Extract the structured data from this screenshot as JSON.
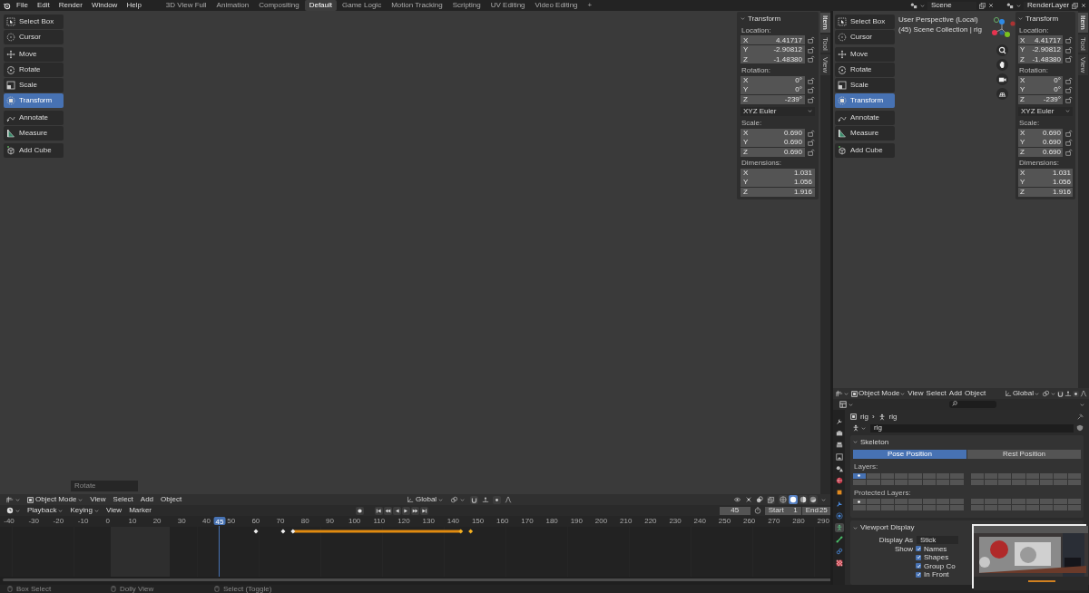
{
  "top_bar": {
    "menus": [
      "File",
      "Edit",
      "Render",
      "Window",
      "Help"
    ],
    "workspaces": [
      {
        "label": "3D View Full",
        "selected": false
      },
      {
        "label": "Animation",
        "selected": false
      },
      {
        "label": "Compositing",
        "selected": false
      },
      {
        "label": "Default",
        "selected": true
      },
      {
        "label": "Game Logic",
        "selected": false
      },
      {
        "label": "Motion Tracking",
        "selected": false
      },
      {
        "label": "Scripting",
        "selected": false
      },
      {
        "label": "UV Editing",
        "selected": false
      },
      {
        "label": "Video Editing",
        "selected": false
      }
    ],
    "add_workspace": "+",
    "scene": "Scene",
    "view_layer": "RenderLayer"
  },
  "main_viewport": {
    "tool_groups": [
      {
        "tools": [
          {
            "label": "Select Box",
            "selected": false
          },
          {
            "label": "Cursor",
            "selected": false
          }
        ]
      },
      {
        "tools": [
          {
            "label": "Move",
            "selected": false
          },
          {
            "label": "Rotate",
            "selected": false
          },
          {
            "label": "Scale",
            "selected": false
          },
          {
            "label": "Transform",
            "selected": true
          }
        ]
      },
      {
        "tools": [
          {
            "label": "Annotate",
            "selected": false
          },
          {
            "label": "Measure",
            "selected": false
          }
        ]
      },
      {
        "tools": [
          {
            "label": "Add Cube",
            "selected": false
          }
        ]
      }
    ],
    "last_operator": "Rotate",
    "sidebar": {
      "title": "Transform",
      "groups": [
        {
          "kind": "vector",
          "label": "Location:",
          "fields": [
            {
              "axis": "X",
              "value": "4.41717",
              "locked": false
            },
            {
              "axis": "Y",
              "value": "-2.90812",
              "locked": false
            },
            {
              "axis": "Z",
              "value": "-1.48380",
              "locked": false
            }
          ]
        },
        {
          "kind": "vector",
          "label": "Rotation:",
          "fields": [
            {
              "axis": "X",
              "value": "0°",
              "locked": false
            },
            {
              "axis": "Y",
              "value": "0°",
              "locked": false
            },
            {
              "axis": "Z",
              "value": "-239°",
              "locked": false
            }
          ]
        },
        {
          "kind": "dropdown",
          "value": "XYZ Euler"
        },
        {
          "kind": "vector",
          "label": "Scale:",
          "fields": [
            {
              "axis": "X",
              "value": "0.690",
              "locked": false
            },
            {
              "axis": "Y",
              "value": "0.690",
              "locked": false
            },
            {
              "axis": "Z",
              "value": "0.690",
              "locked": false
            }
          ]
        },
        {
          "kind": "vector",
          "label": "Dimensions:",
          "fields": [
            {
              "axis": "X",
              "value": "1.031"
            },
            {
              "axis": "Y",
              "value": "1.056"
            },
            {
              "axis": "Z",
              "value": "1.916"
            }
          ]
        }
      ]
    },
    "sidebar_tabs": [
      {
        "label": "Item",
        "selected": true
      },
      {
        "label": "Tool",
        "selected": false
      },
      {
        "label": "View",
        "selected": false
      }
    ],
    "header": {
      "mode": "Object Mode",
      "menus": [
        "View",
        "Select",
        "Add",
        "Object"
      ],
      "orientation": "Global",
      "shading": [
        {
          "selected": false
        },
        {
          "selected": true
        },
        {
          "selected": false
        },
        {
          "selected": false
        }
      ]
    }
  },
  "side_viewport": {
    "overlay_text": [
      "User Perspective (Local)",
      "(45) Scene Collection | rig"
    ],
    "tool_groups": [
      {
        "tools": [
          {
            "label": "Select Box",
            "selected": false
          },
          {
            "label": "Cursor",
            "selected": false
          }
        ]
      },
      {
        "tools": [
          {
            "label": "Move",
            "selected": false
          },
          {
            "label": "Rotate",
            "selected": false
          },
          {
            "label": "Scale",
            "selected": false
          },
          {
            "label": "Transform",
            "selected": true
          }
        ]
      },
      {
        "tools": [
          {
            "label": "Annotate",
            "selected": false
          },
          {
            "label": "Measure",
            "selected": false
          }
        ]
      },
      {
        "tools": [
          {
            "label": "Add Cube",
            "selected": false
          }
        ]
      }
    ],
    "sidebar": {
      "title": "Transform",
      "groups": [
        {
          "kind": "vector",
          "label": "Location:",
          "fields": [
            {
              "axis": "X",
              "value": "4.41717",
              "locked": false
            },
            {
              "axis": "Y",
              "value": "-2.90812",
              "locked": false
            },
            {
              "axis": "Z",
              "value": "-1.48380",
              "locked": false
            }
          ]
        },
        {
          "kind": "vector",
          "label": "Rotation:",
          "fields": [
            {
              "axis": "X",
              "value": "0°",
              "locked": false
            },
            {
              "axis": "Y",
              "value": "0°",
              "locked": false
            },
            {
              "axis": "Z",
              "value": "-239°",
              "locked": false
            }
          ]
        },
        {
          "kind": "dropdown",
          "value": "XYZ Euler"
        },
        {
          "kind": "vector",
          "label": "Scale:",
          "fields": [
            {
              "axis": "X",
              "value": "0.690",
              "locked": false
            },
            {
              "axis": "Y",
              "value": "0.690",
              "locked": false
            },
            {
              "axis": "Z",
              "value": "0.690",
              "locked": false
            }
          ]
        },
        {
          "kind": "vector",
          "label": "Dimensions:",
          "fields": [
            {
              "axis": "X",
              "value": "1.031"
            },
            {
              "axis": "Y",
              "value": "1.056"
            },
            {
              "axis": "Z",
              "value": "1.916"
            }
          ]
        }
      ]
    },
    "sidebar_tabs": [
      {
        "label": "Item",
        "selected": true
      },
      {
        "label": "Tool",
        "selected": false
      },
      {
        "label": "View",
        "selected": false
      }
    ],
    "header": {
      "mode": "Object Mode",
      "menus": [
        "View",
        "Select",
        "Add",
        "Object"
      ],
      "orientation": "Global"
    }
  },
  "timeline": {
    "menus": [
      {
        "label": "Playback",
        "dropdown": true
      },
      {
        "label": "Keying",
        "dropdown": true
      },
      {
        "label": "View",
        "dropdown": false
      },
      {
        "label": "Marker",
        "dropdown": false
      }
    ],
    "current_frame": "45",
    "start_label": "Start",
    "start": "1",
    "end_label": "End",
    "end": "25",
    "ruler": [
      "-40",
      "-30",
      "-20",
      "-10",
      "0",
      "10",
      "20",
      "30",
      "40",
      "50",
      "60",
      "70",
      "80",
      "90",
      "100",
      "110",
      "120",
      "130",
      "140",
      "150",
      "160",
      "170",
      "180",
      "190",
      "200",
      "210",
      "220",
      "230",
      "240",
      "250",
      "260",
      "270",
      "280",
      "290"
    ],
    "playhead": "45"
  },
  "properties": {
    "tabs": [
      {
        "selected": false
      },
      {
        "selected": false
      },
      {
        "selected": false
      },
      {
        "selected": false
      },
      {
        "selected": false
      },
      {
        "selected": false
      },
      {
        "selected": false
      },
      {
        "selected": false
      },
      {
        "selected": false
      },
      {
        "selected": true
      },
      {
        "selected": false
      },
      {
        "selected": false
      },
      {
        "selected": false
      }
    ],
    "breadcrumb": [
      "rig",
      "rig"
    ],
    "breadcrumb_separator": "›",
    "datablock": "rig",
    "skeleton": {
      "title": "Skeleton",
      "pose_options": [
        {
          "label": "Pose Position",
          "selected": true
        },
        {
          "label": "Rest Position",
          "selected": false
        }
      ],
      "layers_label": "Layers:",
      "layers": [
        {
          "selected": true
        },
        {
          "selected": false
        },
        {
          "selected": false
        },
        {
          "selected": false
        },
        {
          "selected": false
        },
        {
          "selected": false
        },
        {
          "selected": false
        },
        {
          "selected": false
        },
        {
          "selected": false
        },
        {
          "selected": false
        },
        {
          "selected": false
        },
        {
          "selected": false
        },
        {
          "selected": false
        },
        {
          "selected": false
        },
        {
          "selected": false
        },
        {
          "selected": false
        },
        {
          "selected": false
        },
        {
          "selected": false
        },
        {
          "selected": false
        },
        {
          "selected": false
        },
        {
          "selected": false
        },
        {
          "selected": false
        },
        {
          "selected": false
        },
        {
          "selected": false
        },
        {
          "selected": false
        },
        {
          "selected": false
        },
        {
          "selected": false
        },
        {
          "selected": false
        },
        {
          "selected": false
        },
        {
          "selected": false
        },
        {
          "selected": false
        },
        {
          "selected": false
        }
      ],
      "protected_label": "Protected Layers:",
      "protected_layers": [
        {
          "on": true
        },
        {
          "on": false
        },
        {
          "on": false
        },
        {
          "on": false
        },
        {
          "on": false
        },
        {
          "on": false
        },
        {
          "on": false
        },
        {
          "on": false
        },
        {
          "on": false
        },
        {
          "on": false
        },
        {
          "on": false
        },
        {
          "on": false
        },
        {
          "on": false
        },
        {
          "on": false
        },
        {
          "on": false
        },
        {
          "on": false
        },
        {
          "on": false
        },
        {
          "on": false
        },
        {
          "on": false
        },
        {
          "on": false
        },
        {
          "on": false
        },
        {
          "on": false
        },
        {
          "on": false
        },
        {
          "on": false
        },
        {
          "on": false
        },
        {
          "on": false
        },
        {
          "on": false
        },
        {
          "on": false
        },
        {
          "on": false
        },
        {
          "on": false
        },
        {
          "on": false
        },
        {
          "on": false
        }
      ]
    },
    "viewport_display": {
      "title": "Viewport Display",
      "display_as_label": "Display As",
      "display_as": "Stick",
      "show_label": "Show",
      "show": [
        {
          "label": "Names",
          "checked": true
        },
        {
          "label": "Shapes",
          "checked": true
        },
        {
          "label": "Group Co",
          "checked": true
        },
        {
          "label": "In Front",
          "checked": true
        }
      ]
    },
    "thumbnail": {
      "kind": "picture"
    }
  },
  "status_bar": [
    {
      "label": "Box Select"
    },
    {
      "label": "Dolly View"
    },
    {
      "label": "Select (Toggle)"
    }
  ]
}
